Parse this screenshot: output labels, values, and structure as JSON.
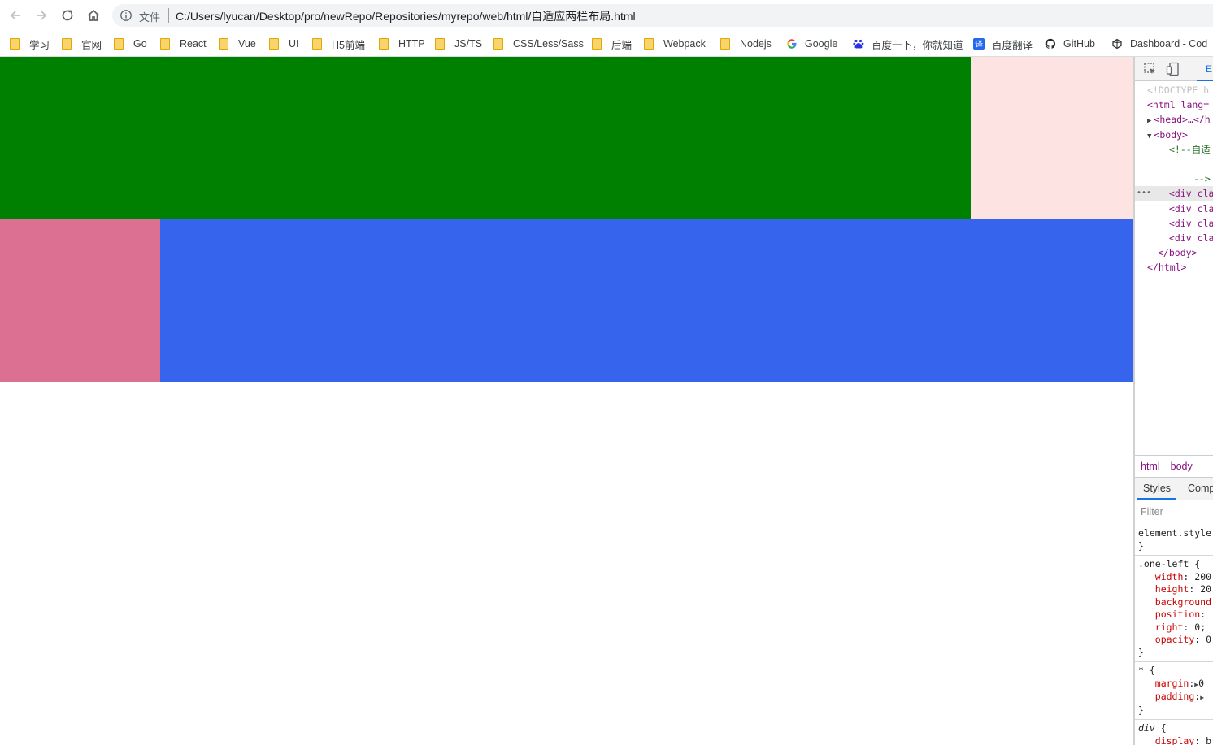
{
  "browser": {
    "omnibox": {
      "scheme_label": "文件",
      "url": "C:/Users/lyucan/Desktop/pro/newRepo/Repositories/myrepo/web/html/自适应两栏布局.html"
    },
    "bookmarks": [
      {
        "label": "学习",
        "icon": "folder-icon"
      },
      {
        "label": "官网",
        "icon": "folder-icon"
      },
      {
        "label": "Go",
        "icon": "folder-icon"
      },
      {
        "label": "React",
        "icon": "folder-icon"
      },
      {
        "label": "Vue",
        "icon": "folder-icon"
      },
      {
        "label": "UI",
        "icon": "folder-icon"
      },
      {
        "label": "H5前端",
        "icon": "folder-icon"
      },
      {
        "label": "HTTP",
        "icon": "folder-icon"
      },
      {
        "label": "JS/TS",
        "icon": "folder-icon"
      },
      {
        "label": "CSS/Less/Sass",
        "icon": "folder-icon"
      },
      {
        "label": "后端",
        "icon": "folder-icon"
      },
      {
        "label": "Webpack",
        "icon": "folder-icon"
      },
      {
        "label": "Nodejs",
        "icon": "folder-icon"
      },
      {
        "label": "Google",
        "icon": "google-icon"
      },
      {
        "label": "百度一下，你就知道",
        "icon": "baidu-icon"
      },
      {
        "label": "百度翻译",
        "icon": "baidu-translate-icon"
      },
      {
        "label": "GitHub",
        "icon": "github-icon"
      },
      {
        "label": "Dashboard - Cod",
        "icon": "codepen-icon"
      }
    ]
  },
  "page": {
    "colors": {
      "one_right": "#008000",
      "one_left": "#fde3e1",
      "two_left": "#db7093",
      "two_right": "#3764ed"
    }
  },
  "devtools": {
    "panel_tab": "E",
    "dom_lines": [
      "<!DOCTYPE h",
      "<html lang=",
      "<head>…</h",
      "<body>",
      "<!--自适",
      "-->",
      "<div cla",
      "<div cla",
      "<div cla",
      "<div cla",
      "</body>",
      "</html>"
    ],
    "breadcrumbs": [
      "html",
      "body"
    ],
    "subtabs": {
      "styles": "Styles",
      "computed": "Comp"
    },
    "filter_placeholder": "Filter",
    "rules": {
      "element_style": "element.style",
      "one_left_selector": ".one-left",
      "one_left_props": [
        {
          "name": "width",
          "value": "200"
        },
        {
          "name": "height",
          "value": "20"
        },
        {
          "name": "background",
          "value": ""
        },
        {
          "name": "position",
          "value": ""
        },
        {
          "name": "right",
          "value": "0;"
        },
        {
          "name": "opacity",
          "value": "0"
        }
      ],
      "star_selector": "*",
      "star_props": [
        {
          "name": "margin",
          "value": "0"
        },
        {
          "name": "padding",
          "value": ""
        }
      ],
      "div_selector": "div",
      "div_props": [
        {
          "name": "display",
          "value": "b"
        }
      ]
    }
  }
}
